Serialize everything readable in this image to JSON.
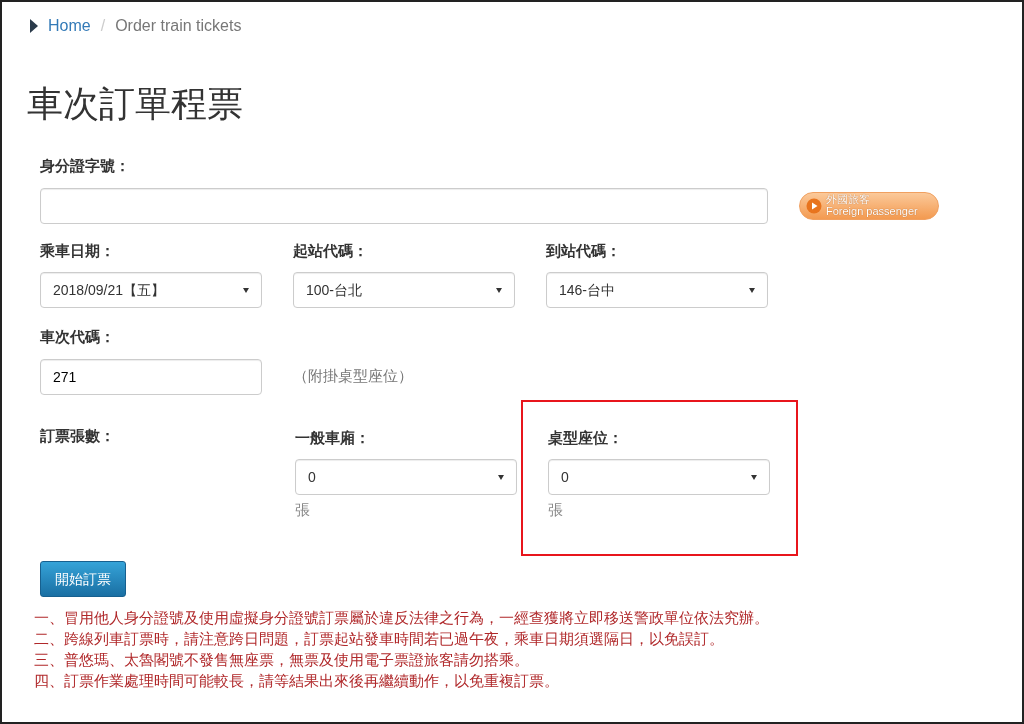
{
  "breadcrumb_separator": "/",
  "breadcrumb": [
    {
      "label": "Home",
      "link": true
    },
    {
      "label": "Order train tickets",
      "link": false
    }
  ],
  "title": "車次訂單程票",
  "id_field": {
    "label": "身分證字號："
  },
  "foreign_button": {
    "line_1": "外國旅客",
    "line_2": "Foreign passenger"
  },
  "selects": [
    {
      "label": "乘車日期：",
      "value": "2018/09/21【五】"
    },
    {
      "label": "起站代碼：",
      "value": "100-台北"
    },
    {
      "label": "到站代碼：",
      "value": "146-台中"
    }
  ],
  "train_field": {
    "label": "車次代碼：",
    "value": "271",
    "note": "（附掛桌型座位）"
  },
  "ticket_count": {
    "label": "訂票張數：",
    "groups": [
      {
        "label": "一般車廂：",
        "value": "0",
        "unit": "張",
        "highlighted": false
      },
      {
        "label": "桌型座位：",
        "value": "0",
        "unit": "張",
        "highlighted": true
      }
    ]
  },
  "submit_button": "開始訂票",
  "notices": [
    "一、冒用他人身分證號及使用虛擬身分證號訂票屬於違反法律之行為，一經查獲將立即移送警政單位依法究辦。",
    "二、跨線列車訂票時，請注意跨日問題，訂票起站發車時間若已過午夜，乘車日期須選隔日，以免誤訂。",
    "三、普悠瑪、太魯閣號不發售無座票，無票及使用電子票證旅客請勿搭乘。",
    "四、訂票作業處理時間可能較長，請等結果出來後再繼續動作，以免重複訂票。"
  ]
}
